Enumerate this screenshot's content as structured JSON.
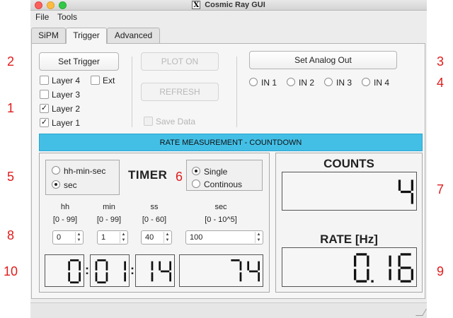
{
  "window": {
    "title": "Cosmic Ray GUI"
  },
  "menu": [
    "File",
    "Tools"
  ],
  "tabs": [
    "SiPM",
    "Trigger",
    "Advanced"
  ],
  "trigger": {
    "set_trigger": "Set Trigger",
    "layers": [
      {
        "label": "Layer 4",
        "checked": false
      },
      {
        "label": "Layer 3",
        "checked": false
      },
      {
        "label": "Layer 2",
        "checked": true
      },
      {
        "label": "Layer 1",
        "checked": true
      }
    ],
    "ext": {
      "label": "Ext",
      "checked": false
    },
    "plot_on": "PLOT ON",
    "refresh": "REFRESH",
    "save_data": "Save Data",
    "set_analog_out": "Set Analog Out",
    "inputs": [
      "IN 1",
      "IN 2",
      "IN 3",
      "IN 4"
    ]
  },
  "rate": {
    "banner": "RATE MEASUREMENT - COUNTDOWN",
    "format_options": [
      "hh-min-sec",
      "sec"
    ],
    "format_selected": "sec",
    "timer_label": "TIMER",
    "mode_options": [
      "Single",
      "Continous"
    ],
    "mode_selected": "Single",
    "fields": [
      {
        "name": "hh",
        "range": "[0 - 99]",
        "value": "0"
      },
      {
        "name": "min",
        "range": "[0 - 99]",
        "value": "1"
      },
      {
        "name": "ss",
        "range": "[0 - 60]",
        "value": "40"
      },
      {
        "name": "sec",
        "range": "[0 - 10^5]",
        "value": "100"
      }
    ],
    "lcd_timer": {
      "hh": "0",
      "min": "01",
      "ss": "14",
      "sec": "74"
    },
    "counts_label": "COUNTS",
    "counts_value": "4",
    "rate_label": "RATE [Hz]",
    "rate_value": "0.16"
  },
  "annotations": [
    "1",
    "2",
    "3",
    "4",
    "5",
    "6",
    "7",
    "8",
    "9",
    "10"
  ],
  "colors": {
    "banner": "#43bfe6",
    "annotation": "#e01c1c"
  }
}
